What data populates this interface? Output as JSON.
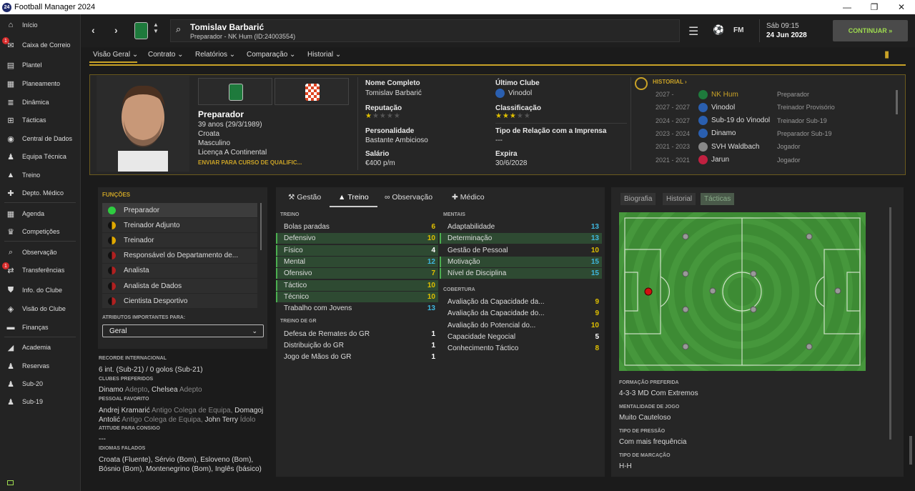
{
  "window": {
    "title": "Football Manager 2024",
    "icon": "24"
  },
  "sidebar": {
    "items": [
      {
        "label": "Início",
        "icon": "home-icon"
      },
      {
        "label": "Caixa de Correio",
        "icon": "mail-icon",
        "badge": "1"
      },
      {
        "label": "Plantel",
        "icon": "squad-icon"
      },
      {
        "label": "Planeamento",
        "icon": "planning-icon"
      },
      {
        "label": "Dinâmica",
        "icon": "dynamics-icon"
      },
      {
        "label": "Tácticas",
        "icon": "tactics-icon"
      },
      {
        "label": "Central de Dados",
        "icon": "data-icon"
      },
      {
        "label": "Equipa Técnica",
        "icon": "staff-icon"
      },
      {
        "label": "Treino",
        "icon": "training-icon"
      },
      {
        "label": "Depto. Médico",
        "icon": "medical-icon"
      },
      {
        "label": "Agenda",
        "icon": "calendar-icon"
      },
      {
        "label": "Competições",
        "icon": "trophy-icon"
      },
      {
        "label": "Observação",
        "icon": "scouting-icon"
      },
      {
        "label": "Transferências",
        "icon": "transfer-icon",
        "badge": "1"
      },
      {
        "label": "Info. do Clube",
        "icon": "club-icon"
      },
      {
        "label": "Visão do Clube",
        "icon": "vision-icon"
      },
      {
        "label": "Finanças",
        "icon": "finance-icon"
      },
      {
        "label": "Academia",
        "icon": "academy-icon"
      },
      {
        "label": "Reservas",
        "icon": "reserves-icon"
      },
      {
        "label": "Sub-20",
        "icon": "u20-icon"
      },
      {
        "label": "Sub-19",
        "icon": "u19-icon"
      }
    ]
  },
  "header": {
    "name": "Tomislav Barbarić",
    "subtitle": "Preparador - NK Hum (ID:24003554)",
    "day": "Sáb 09:15",
    "date": "24 Jun 2028",
    "continue": "CONTINUAR",
    "fm": "FM"
  },
  "subnav": [
    "Visão Geral",
    "Contrato",
    "Relatórios",
    "Comparação",
    "Historial"
  ],
  "profile": {
    "role": "Preparador",
    "age": "39 anos",
    "dob": "(29/3/1989)",
    "nationality": "Croata",
    "gender": "Masculino",
    "license": "Licença A Continental",
    "course_link": "ENVIAR PARA CURSO DE QUALIFIC...",
    "full_name_label": "Nome Completo",
    "full_name": "Tomislav Barbarić",
    "last_club_label": "Último Clube",
    "last_club": "Vinodol",
    "reputation_label": "Reputação",
    "reputation_stars": 1,
    "rating_label": "Classificação",
    "rating_stars": 3,
    "personality_label": "Personalidade",
    "personality": "Bastante Ambicioso",
    "press_label": "Tipo de Relação com a Imprensa",
    "press": "---",
    "salary_label": "Salário",
    "salary": "€400 p/m",
    "expires_label": "Expira",
    "expires": "30/6/2028"
  },
  "history": {
    "title": "HISTORIAL",
    "rows": [
      {
        "years": "2027 -",
        "club": "NK Hum",
        "role": "Preparador"
      },
      {
        "years": "2027 - 2027",
        "club": "Vinodol",
        "role": "Treinador Provisório"
      },
      {
        "years": "2024 - 2027",
        "club": "Sub-19 do Vinodol",
        "role": "Treinador Sub-19"
      },
      {
        "years": "2023 - 2024",
        "club": "Dinamo",
        "role": "Preparador Sub-19"
      },
      {
        "years": "2021 - 2023",
        "club": "SVH Waldbach",
        "role": "Jogador"
      },
      {
        "years": "2021 - 2021",
        "club": "Jarun",
        "role": "Jogador"
      }
    ]
  },
  "roles": {
    "title": "FUNÇÕES",
    "items": [
      {
        "label": "Preparador",
        "color": "#2ecc40"
      },
      {
        "label": "Treinador Adjunto",
        "color": "#e0a800"
      },
      {
        "label": "Treinador",
        "color": "#e0a800"
      },
      {
        "label": "Responsável do Departamento de...",
        "color": "#b02020"
      },
      {
        "label": "Analista",
        "color": "#b02020"
      },
      {
        "label": "Analista de Dados",
        "color": "#b02020"
      },
      {
        "label": "Cientista Desportivo",
        "color": "#b02020"
      }
    ],
    "attr_label": "ATRIBUTOS IMPORTANTES PARA:",
    "attr_value": "Geral"
  },
  "info": {
    "intl_label": "RECORDE INTERNACIONAL",
    "intl": "6 int. (Sub-21) / 0 golos (Sub-21)",
    "clubs_label": "CLUBES PREFERIDOS",
    "club1": "Dinamo",
    "club1_tag": "Adepto",
    "club2": "Chelsea",
    "club2_tag": "Adepto",
    "people_label": "PESSOAL FAVORITO",
    "p1": "Andrej Kramarić",
    "p1_tag": "Antigo Colega de Equipa,",
    "p2": "Domagoj",
    "p2b": "Antolić",
    "p2_tag": "Antigo Colega de Equipa,",
    "p3": "John Terry",
    "p3_tag": "Ídolo",
    "attitude_label": "ATITUDE PARA CONSIGO",
    "attitude": "---",
    "lang_label": "IDIOMAS FALADOS",
    "lang1": "Croata (Fluente), Sérvio (Bom), Esloveno (Bom),",
    "lang2": "Bósnio (Bom), Montenegrino (Bom), Inglês (básico)"
  },
  "tabs": [
    "Gestão",
    "Treino",
    "Observação",
    "Médico"
  ],
  "training": {
    "label": "TREINO",
    "rows": [
      {
        "name": "Bolas paradas",
        "value": 6,
        "hl": false,
        "color": "#e0c000"
      },
      {
        "name": "Defensivo",
        "value": 10,
        "hl": true,
        "color": "#e0c000"
      },
      {
        "name": "Físico",
        "value": 4,
        "hl": true,
        "color": "#ffffff"
      },
      {
        "name": "Mental",
        "value": 12,
        "hl": true,
        "color": "#3fb8e0"
      },
      {
        "name": "Ofensivo",
        "value": 7,
        "hl": true,
        "color": "#e0c000"
      },
      {
        "name": "Táctico",
        "value": 10,
        "hl": true,
        "color": "#e0c000"
      },
      {
        "name": "Técnico",
        "value": 10,
        "hl": true,
        "color": "#e0c000"
      },
      {
        "name": "Trabalho com Jovens",
        "value": 13,
        "hl": false,
        "color": "#3fb8e0"
      }
    ]
  },
  "gk": {
    "label": "TREINO DE GR",
    "rows": [
      {
        "name": "Defesa de Remates do GR",
        "value": 1,
        "color": "#ffffff"
      },
      {
        "name": "Distribuição do GR",
        "value": 1,
        "color": "#ffffff"
      },
      {
        "name": "Jogo de Mãos do GR",
        "value": 1,
        "color": "#ffffff"
      }
    ]
  },
  "mental": {
    "label": "MENTAIS",
    "rows": [
      {
        "name": "Adaptabilidade",
        "value": 13,
        "hl": false,
        "color": "#3fb8e0"
      },
      {
        "name": "Determinação",
        "value": 13,
        "hl": true,
        "color": "#3fb8e0"
      },
      {
        "name": "Gestão de Pessoal",
        "value": 10,
        "hl": false,
        "color": "#e0c000"
      },
      {
        "name": "Motivação",
        "value": 15,
        "hl": true,
        "color": "#3fb8e0"
      },
      {
        "name": "Nível de Disciplina",
        "value": 15,
        "hl": true,
        "color": "#3fb8e0"
      }
    ]
  },
  "coverage": {
    "label": "COBERTURA",
    "rows": [
      {
        "name": "Avaliação da Capacidade da...",
        "value": 9,
        "color": "#e0c000"
      },
      {
        "name": "Avaliação da Capacidade do...",
        "value": 9,
        "color": "#e0c000"
      },
      {
        "name": "Avaliação do Potencial do...",
        "value": 10,
        "color": "#e0c000"
      },
      {
        "name": "Capacidade Negocial",
        "value": 5,
        "color": "#ffffff"
      },
      {
        "name": "Conhecimento Táctico",
        "value": 8,
        "color": "#e0c000"
      }
    ]
  },
  "right_tabs": [
    "Biografia",
    "Historial",
    "Tácticas"
  ],
  "tactics": {
    "formation_label": "FORMAÇÃO PREFERIDA",
    "formation": "4-3-3 MD Com Extremos",
    "mentality_label": "MENTALIDADE DE JOGO",
    "mentality": "Muito Cauteloso",
    "press_label": "TIPO DE PRESSÃO",
    "press": "Com mais frequência",
    "marking_label": "TIPO DE MARCAÇÃO",
    "marking": "H-H"
  },
  "colors": {
    "accent": "#c9a227",
    "positive": "#9fdc4f",
    "pitch": "#3d8b34"
  }
}
